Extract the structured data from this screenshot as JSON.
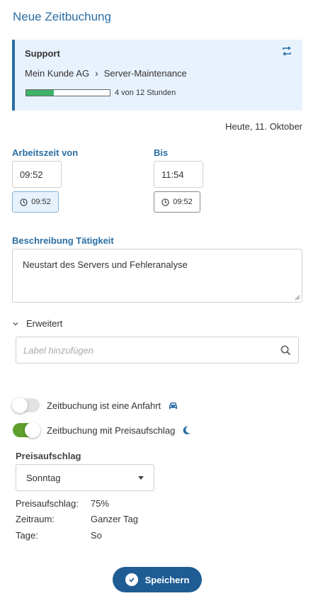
{
  "page": {
    "title": "Neue Zeitbuchung"
  },
  "card": {
    "type": "Support",
    "customer": "Mein Kunde AG",
    "project": "Server-Maintenance",
    "progress_fraction": 0.333,
    "progress_text": "4 von 12 Stunden",
    "swap_icon": "swap-arrows-icon"
  },
  "date_label": "Heute, 11. Oktober",
  "from": {
    "label": "Arbeitszeit von",
    "value": "09:52",
    "now_button": "09:52"
  },
  "to": {
    "label": "Bis",
    "value": "11:54",
    "now_button": "09:52"
  },
  "description": {
    "label": "Beschreibung Tätigkeit",
    "value": "Neustart des Servers und Fehleranalyse"
  },
  "advanced": {
    "label": "Erweitert",
    "label_placeholder": "Label hinzufügen"
  },
  "toggles": {
    "travel": {
      "label": "Zeitbuchung ist eine Anfahrt",
      "on": false,
      "icon": "car-icon"
    },
    "surcharge": {
      "label": "Zeitbuchung mit Preisaufschlag",
      "on": true,
      "icon": "moon-icon"
    }
  },
  "surcharge": {
    "label": "Preisaufschlag",
    "selected": "Sonntag",
    "details": [
      {
        "label": "Preisaufschlag:",
        "value": "75%"
      },
      {
        "label": "Zeitraum:",
        "value": "Ganzer Tag"
      },
      {
        "label": "Tage:",
        "value": "So"
      }
    ]
  },
  "save_label": "Speichern",
  "colors": {
    "accent": "#2b6ea3",
    "progress": "#3fb36a",
    "toggle_on": "#5e9f2d",
    "save_button": "#1f5c93"
  }
}
